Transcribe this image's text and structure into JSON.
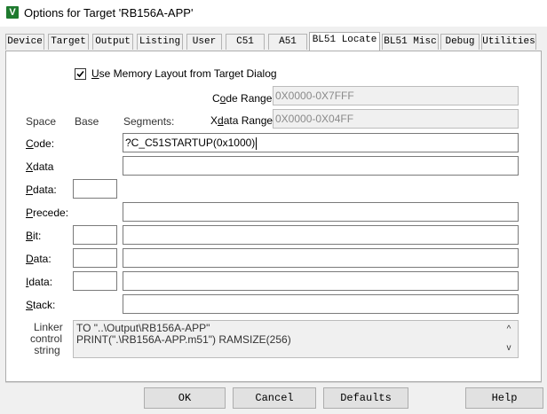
{
  "window": {
    "title": "Options for Target 'RB156A-APP'",
    "icon": "keil-v-icon",
    "icon_glyph": "V"
  },
  "tabs": [
    {
      "label": "Device"
    },
    {
      "label": "Target"
    },
    {
      "label": "Output"
    },
    {
      "label": "Listing"
    },
    {
      "label": "User"
    },
    {
      "label": "C51"
    },
    {
      "label": "A51"
    },
    {
      "label": "BL51 Locate",
      "active": true
    },
    {
      "label": "BL51 Misc"
    },
    {
      "label": "Debug"
    },
    {
      "label": "Utilities"
    }
  ],
  "memory_layout": {
    "label": "Use Memory Layout from Target Dialog",
    "accel": "U",
    "rest": "se Memory Layout from Target Dialog",
    "checked": true
  },
  "code_range": {
    "label_pre": "C",
    "label_accel": "o",
    "label_post": "de Range:",
    "value": "0X0000-0X7FFF"
  },
  "xdata_range": {
    "label_pre": "X",
    "label_accel": "d",
    "label_post": "ata Range:",
    "value": "0X0000-0X04FF"
  },
  "headers": {
    "space": "Space",
    "base": "Base",
    "segments": "Segments:"
  },
  "rows": {
    "code": {
      "accel": "C",
      "rest": "ode:",
      "segments": "?C_C51STARTUP(0x1000)"
    },
    "xdata": {
      "accel": "X",
      "rest": "data",
      "segments": ""
    },
    "pdata": {
      "accel": "P",
      "rest": "data:",
      "base": ""
    },
    "precede": {
      "accel": "P",
      "rest": "recede:",
      "segments": ""
    },
    "bit": {
      "accel": "B",
      "rest": "it:",
      "base": "",
      "segments": ""
    },
    "data": {
      "accel": "D",
      "rest": "ata:",
      "base": "",
      "segments": ""
    },
    "idata": {
      "accel": "I",
      "rest": "data:",
      "base": "",
      "segments": ""
    },
    "stack": {
      "accel": "S",
      "rest": "tack:",
      "segments": ""
    }
  },
  "linker": {
    "label_lines": [
      "Linker",
      "control",
      "string"
    ],
    "lines": [
      "TO \"..\\Output\\RB156A-APP\"",
      "PRINT(\".\\RB156A-APP.m51\") RAMSIZE(256)"
    ],
    "scroll_up": "^",
    "scroll_down": "v"
  },
  "buttons": {
    "ok": "OK",
    "cancel": "Cancel",
    "defaults": "Defaults",
    "help": "Help"
  }
}
